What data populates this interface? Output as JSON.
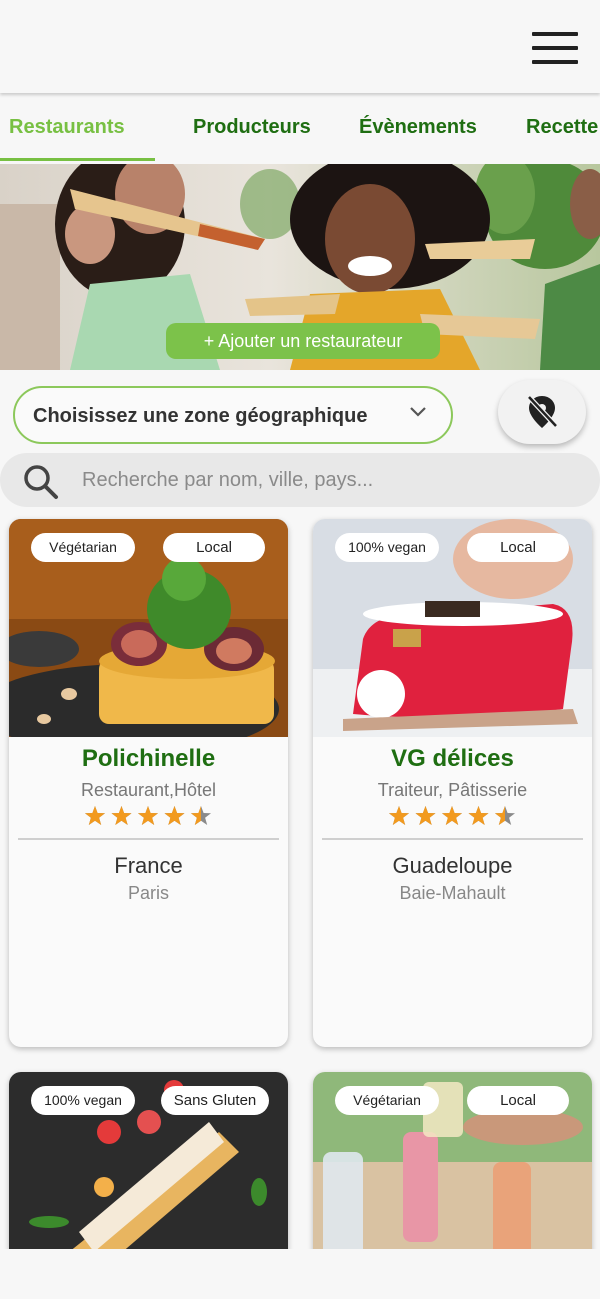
{
  "tabs": [
    {
      "label": "Restaurants",
      "active": true
    },
    {
      "label": "Producteurs",
      "active": false
    },
    {
      "label": "Évènements",
      "active": false
    },
    {
      "label": "Recette",
      "active": false
    }
  ],
  "hero": {
    "add_button": "+ Ajouter un restaurateur"
  },
  "zone": {
    "placeholder": "Choisissez une zone géographique"
  },
  "search": {
    "placeholder": "Recherche par nom, ville, pays..."
  },
  "cards": [
    {
      "badge_left": "Végétarian",
      "badge_right": "Local",
      "name": "Polichinelle",
      "type": "Restaurant,Hôtel",
      "rating": 4.5,
      "country": "France",
      "city": "Paris"
    },
    {
      "badge_left": "100% vegan",
      "badge_right": "Local",
      "name": "VG délices",
      "type": "Traiteur, Pâtisserie",
      "rating": 4.5,
      "country": "Guadeloupe",
      "city": "Baie-Mahault"
    },
    {
      "badge_left": "100% vegan",
      "badge_right": "Sans Gluten"
    },
    {
      "badge_left": "Végétarian",
      "badge_right": "Local"
    }
  ],
  "colors": {
    "accent": "#78c043",
    "brand_dark": "#1f6e12",
    "star": "#f29a1f"
  },
  "icons": [
    "hamburger-menu-icon",
    "chevron-down-icon",
    "location-off-icon",
    "search-icon",
    "star-icon"
  ]
}
